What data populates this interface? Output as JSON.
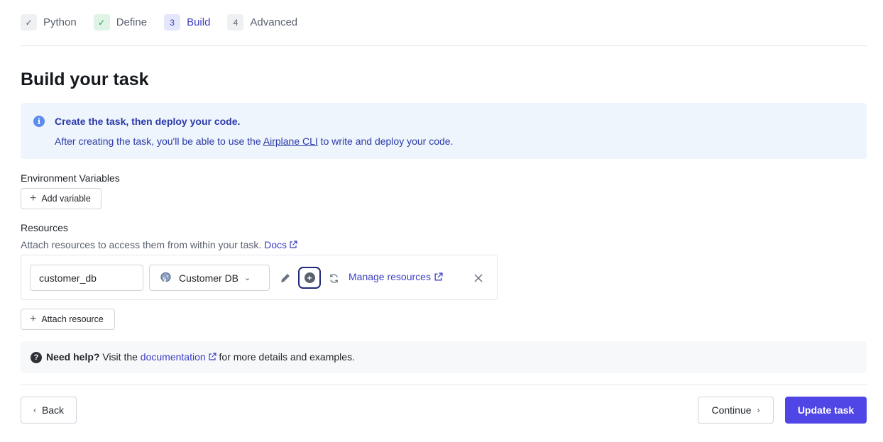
{
  "stepper": {
    "steps": [
      {
        "badge": "✓",
        "label": "Python"
      },
      {
        "badge": "✓",
        "label": "Define"
      },
      {
        "badge": "3",
        "label": "Build"
      },
      {
        "badge": "4",
        "label": "Advanced"
      }
    ]
  },
  "page": {
    "title": "Build your task"
  },
  "banner": {
    "title": "Create the task, then deploy your code.",
    "body_before": "After creating the task, you'll be able to use the ",
    "link": "Airplane CLI",
    "body_after": " to write and deploy your code."
  },
  "env": {
    "label": "Environment Variables",
    "add_label": "Add variable"
  },
  "resources": {
    "label": "Resources",
    "subtext": "Attach resources to access them from within your task.",
    "docs_label": "Docs",
    "alias_value": "customer_db",
    "selected_resource": "Customer DB",
    "manage_label": "Manage resources",
    "attach_label": "Attach resource"
  },
  "help": {
    "bold": "Need help?",
    "before": " Visit the ",
    "link": "documentation",
    "after": " for more details and examples."
  },
  "footer": {
    "back_label": "Back",
    "continue_label": "Continue",
    "update_label": "Update task"
  },
  "colors": {
    "accent": "#4f46e5",
    "link": "#3b3fc4",
    "banner_bg": "#eef5fd"
  }
}
